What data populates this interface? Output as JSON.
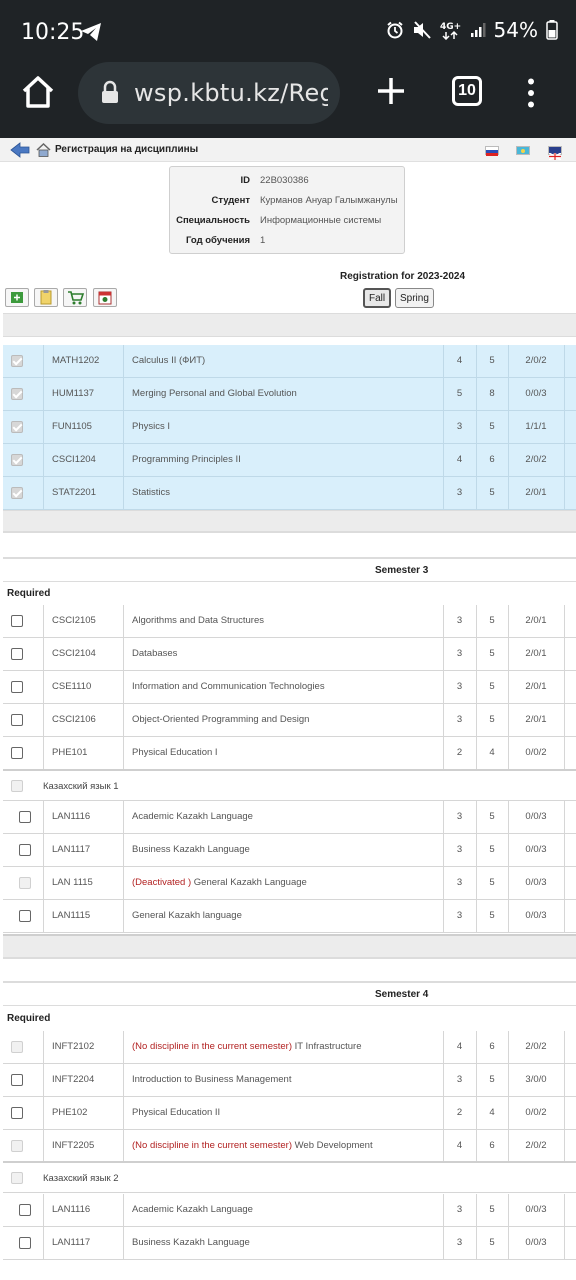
{
  "status": {
    "time": "10:25",
    "battery": "54%",
    "net": "4G+"
  },
  "browser": {
    "url": "wsp.kbtu.kz/Reg",
    "tabs_count": "10"
  },
  "nav": {
    "breadcrumb": "Регистрация на дисциплины"
  },
  "student": {
    "id_label": "ID",
    "id": "22B030386",
    "student_label": "Студент",
    "name": "Курманов Ануар Галымжанулы",
    "spec_label": "Специальность",
    "spec": "Информационные системы",
    "year_label": "Год обучения",
    "year": "1"
  },
  "registration": {
    "title": "Registration for 2023-2024",
    "fall": "Fall",
    "spring": "Spring"
  },
  "selected": [
    {
      "code": "MATH1202",
      "name": "Calculus II (ФИТ)",
      "c1": "4",
      "c2": "5",
      "c3": "2/0/2"
    },
    {
      "code": "HUM1137",
      "name": "Merging Personal and Global Evolution",
      "c1": "5",
      "c2": "8",
      "c3": "0/0/3"
    },
    {
      "code": "FUN1105",
      "name": "Physics I",
      "c1": "3",
      "c2": "5",
      "c3": "1/1/1"
    },
    {
      "code": "CSCI1204",
      "name": "Programming Principles II",
      "c1": "4",
      "c2": "6",
      "c3": "2/0/2"
    },
    {
      "code": "STAT2201",
      "name": "Statistics",
      "c1": "3",
      "c2": "5",
      "c3": "2/0/1"
    }
  ],
  "semester3": {
    "title": "Semester 3",
    "required_label": "Required",
    "required": [
      {
        "code": "CSCI2105",
        "name": "Algorithms and Data Structures",
        "c1": "3",
        "c2": "5",
        "c3": "2/0/1"
      },
      {
        "code": "CSCI2104",
        "name": "Databases",
        "c1": "3",
        "c2": "5",
        "c3": "2/0/1"
      },
      {
        "code": "CSE1110",
        "name": "Information and Communication Technologies",
        "c1": "3",
        "c2": "5",
        "c3": "2/0/1"
      },
      {
        "code": "CSCI2106",
        "name": "Object-Oriented Programming and Design",
        "c1": "3",
        "c2": "5",
        "c3": "2/0/1"
      },
      {
        "code": "PHE101",
        "name": "Physical Education I",
        "c1": "2",
        "c2": "4",
        "c3": "0/0/2"
      }
    ],
    "group_label": "Казахский язык 1",
    "group": [
      {
        "code": "LAN1116",
        "prefix": "",
        "name": "Academic Kazakh Language",
        "c1": "3",
        "c2": "5",
        "c3": "0/0/3"
      },
      {
        "code": "LAN1117",
        "prefix": "",
        "name": "Business Kazakh Language",
        "c1": "3",
        "c2": "5",
        "c3": "0/0/3"
      },
      {
        "code": "LAN 1115",
        "prefix": "(Deactivated )",
        "name": "General Kazakh Language",
        "c1": "3",
        "c2": "5",
        "c3": "0/0/3"
      },
      {
        "code": "LAN1115",
        "prefix": "",
        "name": "General Kazakh language",
        "c1": "3",
        "c2": "5",
        "c3": "0/0/3"
      }
    ]
  },
  "semester4": {
    "title": "Semester 4",
    "required_label": "Required",
    "required": [
      {
        "code": "INFT2102",
        "prefix": "(No discipline in the current semester)",
        "name": "IT Infrastructure",
        "c1": "4",
        "c2": "6",
        "c3": "2/0/2"
      },
      {
        "code": "INFT2204",
        "prefix": "",
        "name": "Introduction to Business Management",
        "c1": "3",
        "c2": "5",
        "c3": "3/0/0"
      },
      {
        "code": "PHE102",
        "prefix": "",
        "name": "Physical Education II",
        "c1": "2",
        "c2": "4",
        "c3": "0/0/2"
      },
      {
        "code": "INFT2205",
        "prefix": "(No discipline in the current semester)",
        "name": "Web Development",
        "c1": "4",
        "c2": "6",
        "c3": "2/0/2"
      }
    ],
    "group_label": "Казахский язык 2",
    "group": [
      {
        "code": "LAN1116",
        "prefix": "",
        "name": "Academic Kazakh Language",
        "c1": "3",
        "c2": "5",
        "c3": "0/0/3"
      },
      {
        "code": "LAN1117",
        "prefix": "",
        "name": "Business Kazakh Language",
        "c1": "3",
        "c2": "5",
        "c3": "0/0/3"
      }
    ]
  }
}
